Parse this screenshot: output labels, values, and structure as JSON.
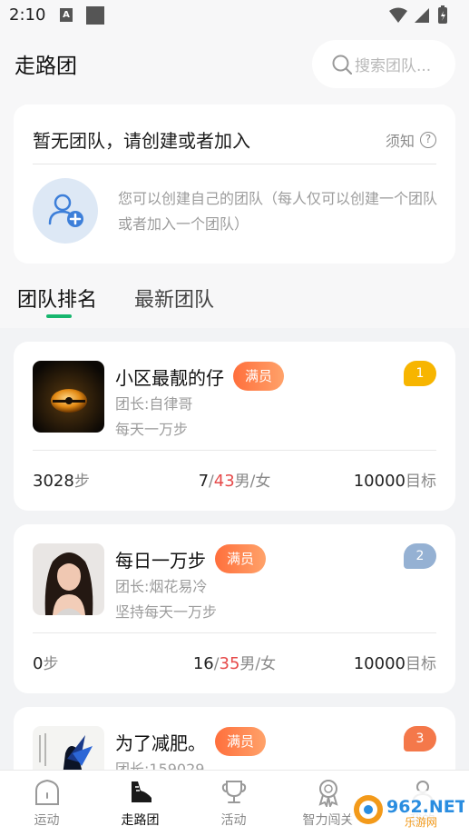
{
  "status_bar": {
    "time": "2:10",
    "a_icon": "A"
  },
  "header": {
    "title": "走路团",
    "search_placeholder": "搜索团队..."
  },
  "no_team": {
    "title": "暂无团队，请创建或者加入",
    "notice": "须知",
    "notice_q": "?",
    "description": "您可以创建自己的团队（每人仅可以创建一个团队或者加入一个团队）"
  },
  "tabs": [
    {
      "label": "团队排名",
      "active": true
    },
    {
      "label": "最新团队",
      "active": false
    }
  ],
  "teams": [
    {
      "name": "小区最靓的仔",
      "badge": "满员",
      "leader": "团长:自律哥",
      "slogan": "每天一万步",
      "rank": "1",
      "rank_color": "#f7b500",
      "steps": "3028",
      "steps_unit": "步",
      "male": "7",
      "female": "43",
      "gender_unit": "男/女",
      "goal": "10000",
      "goal_unit": "目标"
    },
    {
      "name": "每日一万步",
      "badge": "满员",
      "leader": "团长:烟花易冷",
      "slogan": "坚持每天一万步",
      "rank": "2",
      "rank_color": "#95b1d3",
      "steps": "0",
      "steps_unit": "步",
      "male": "16",
      "female": "35",
      "gender_unit": "男/女",
      "goal": "10000",
      "goal_unit": "目标"
    },
    {
      "name": "为了减肥。",
      "badge": "满员",
      "leader": "团长:159029",
      "rank": "3",
      "rank_color": "#f4784a"
    }
  ],
  "bottom_nav": [
    {
      "label": "运动",
      "icon": "home-icon",
      "active": false
    },
    {
      "label": "走路团",
      "icon": "shoe-icon",
      "active": true
    },
    {
      "label": "活动",
      "icon": "trophy-icon",
      "active": false
    },
    {
      "label": "智力闯关",
      "icon": "medal-icon",
      "active": false
    },
    {
      "label": "我的",
      "icon": "profile-icon",
      "active": false
    }
  ],
  "watermark": {
    "text": "962.NET",
    "subtext": "乐游网"
  },
  "colors": {
    "accent": "#17b66e",
    "badge_orange": "#ff7a45",
    "female_red": "#e64a4a"
  }
}
